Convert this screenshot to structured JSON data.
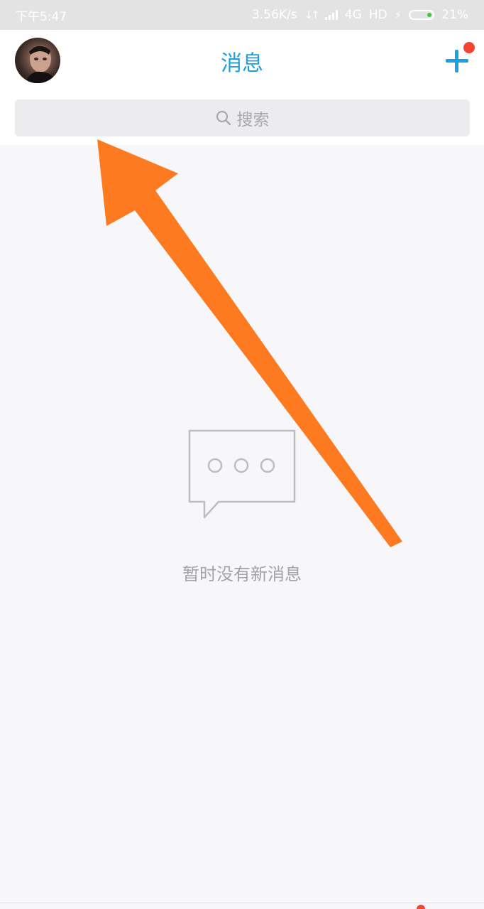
{
  "status_bar": {
    "time": "下午5:47",
    "speed": "3.56K/s",
    "network": "4G",
    "hd": "HD",
    "battery": "21%"
  },
  "header": {
    "title": "消息"
  },
  "search": {
    "placeholder": "搜索"
  },
  "empty_state": {
    "message": "暂时没有新消息"
  },
  "colors": {
    "accent": "#1aa3e2",
    "notify": "#f2452f",
    "arrow": "#fd7a21"
  },
  "icons": [
    "search-icon",
    "chat-bubble-icon",
    "plus-icon",
    "battery-icon",
    "signal-icon"
  ]
}
